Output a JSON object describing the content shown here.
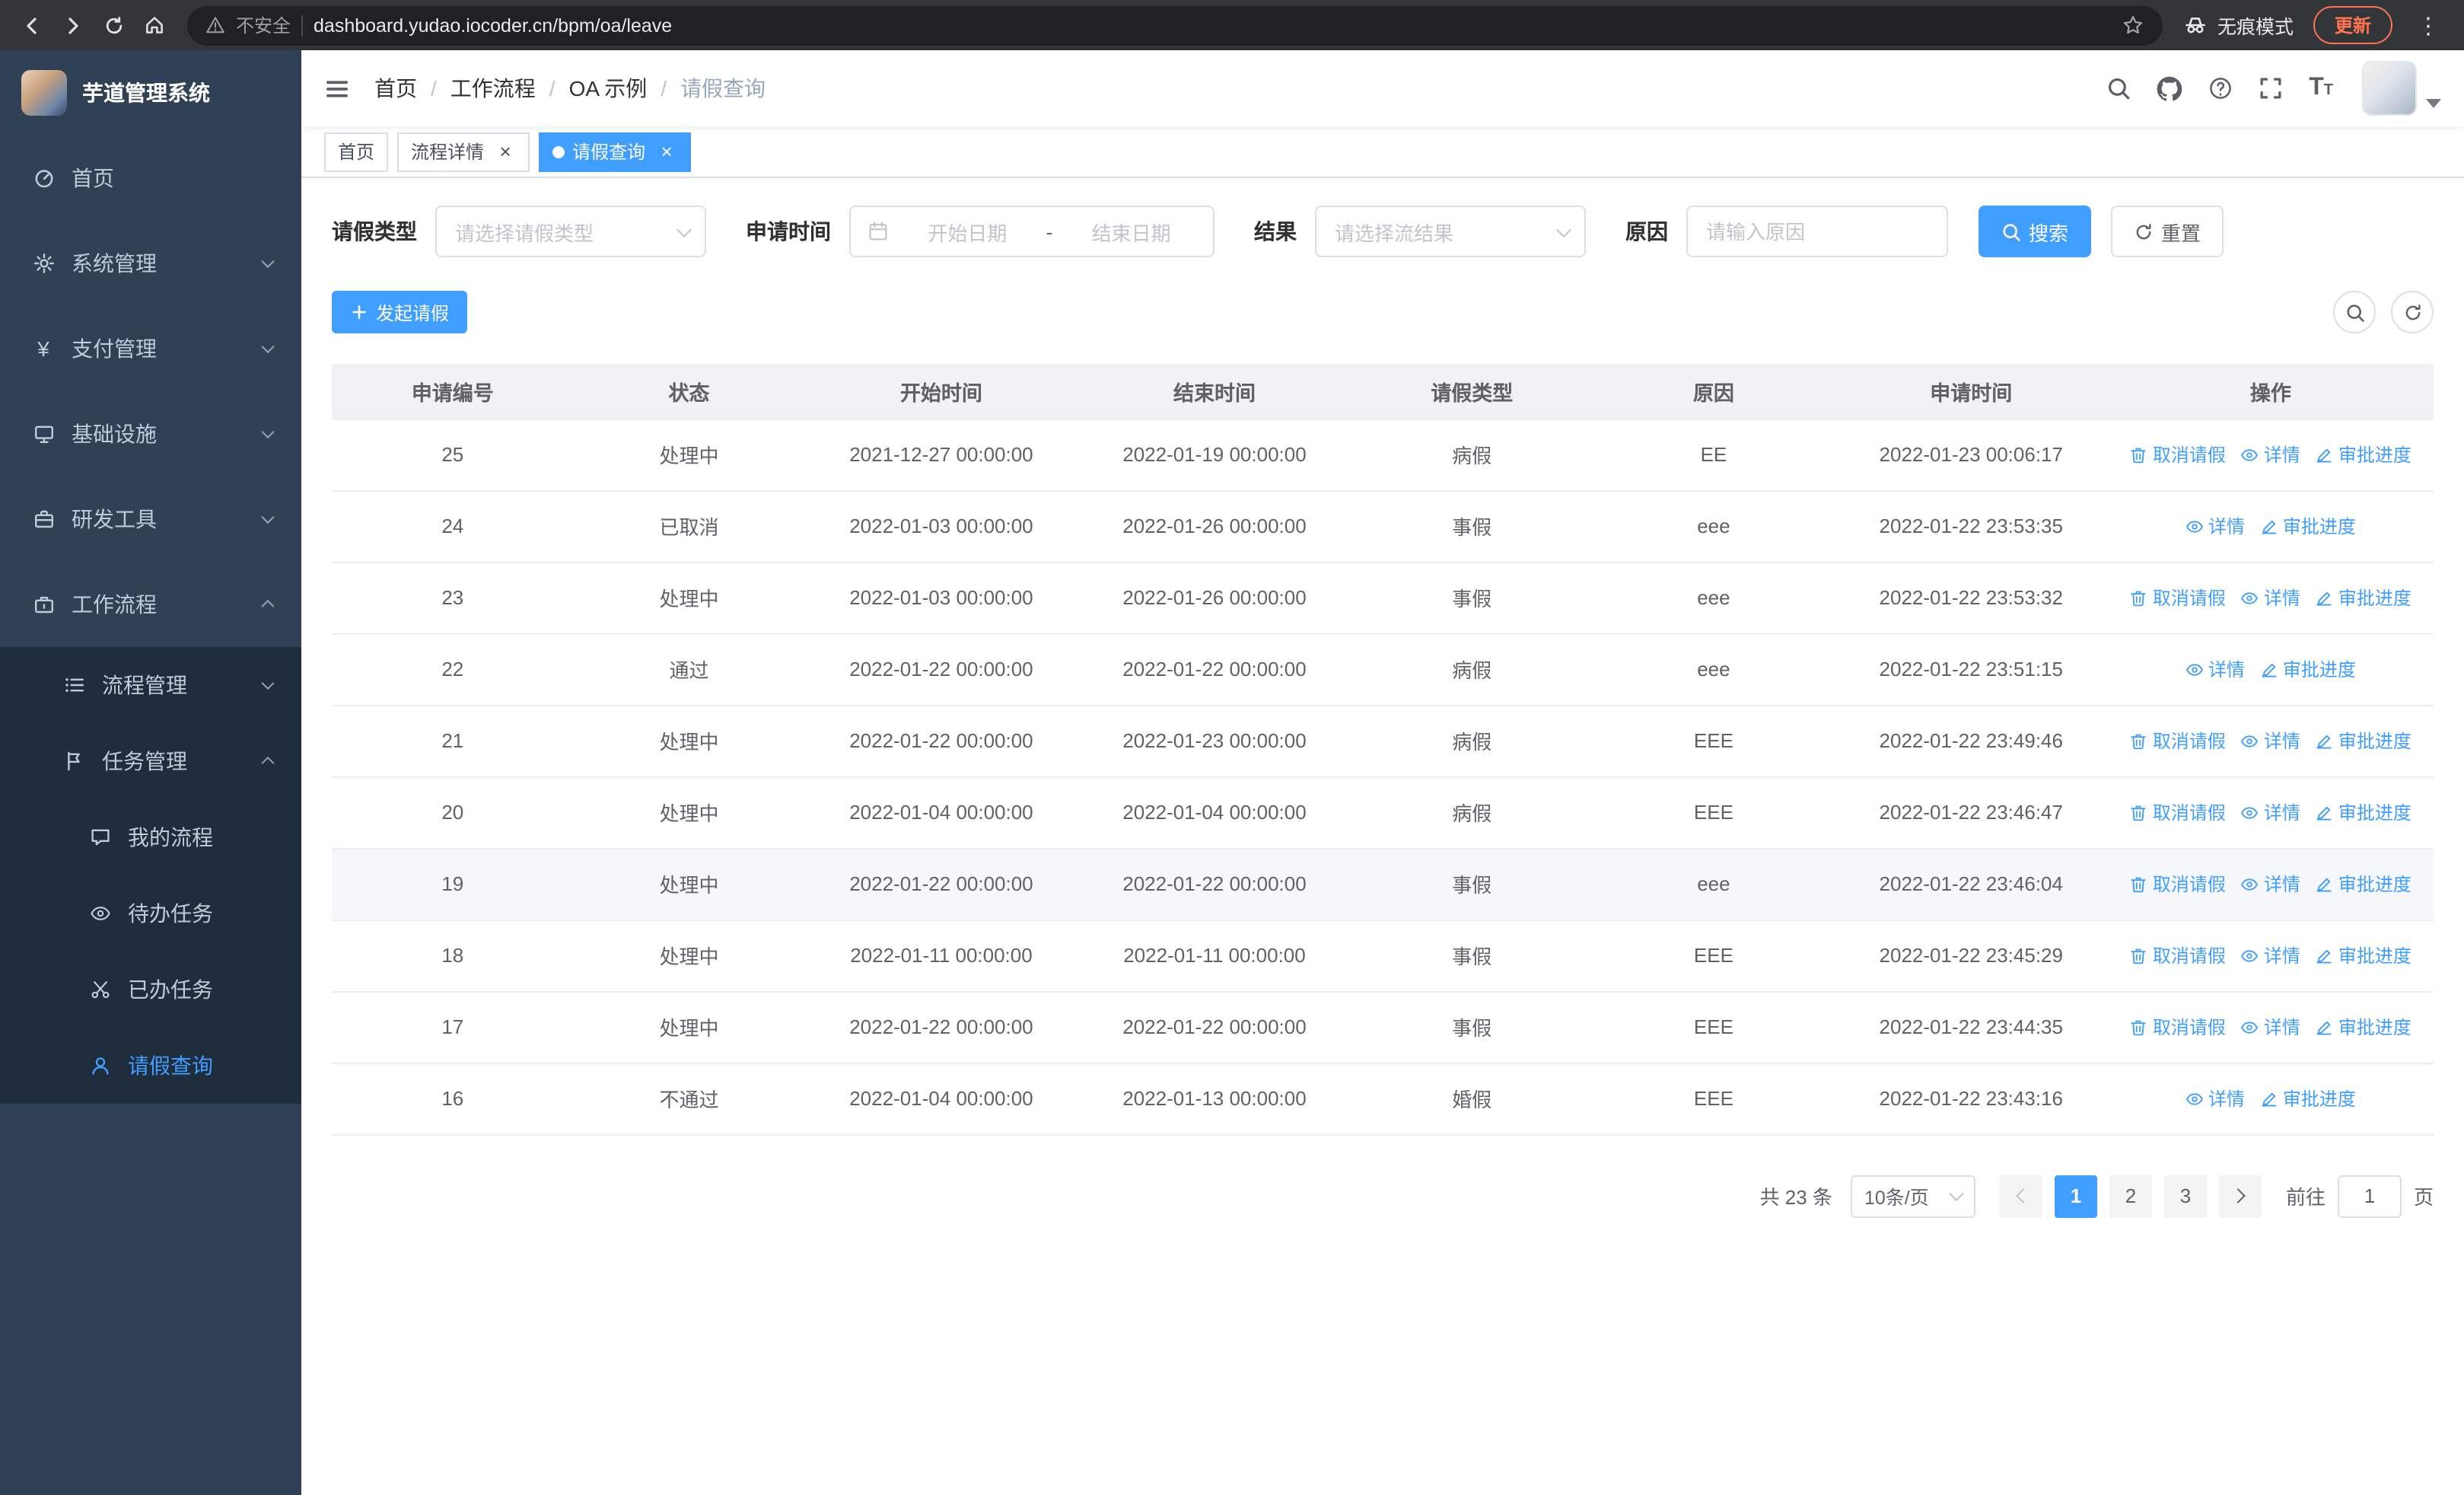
{
  "browser": {
    "security_label": "不安全",
    "url": "dashboard.yudao.iocoder.cn/bpm/oa/leave",
    "incognito_label": "无痕模式",
    "update_label": "更新"
  },
  "sidebar": {
    "title": "芋道管理系统",
    "items": [
      {
        "key": "home",
        "label": "首页",
        "icon": "dashboard",
        "level": 1
      },
      {
        "key": "system-management",
        "label": "系统管理",
        "icon": "gear",
        "level": 1,
        "arrow": "down"
      },
      {
        "key": "payment-management",
        "label": "支付管理",
        "icon": "yen",
        "level": 1,
        "arrow": "down"
      },
      {
        "key": "infrastructure",
        "label": "基础设施",
        "icon": "monitor",
        "level": 1,
        "arrow": "down"
      },
      {
        "key": "dev-tools",
        "label": "研发工具",
        "icon": "tools",
        "level": 1,
        "arrow": "down"
      },
      {
        "key": "workflow",
        "label": "工作流程",
        "icon": "workflow",
        "level": 1,
        "arrow": "up"
      },
      {
        "key": "process-management",
        "label": "流程管理",
        "icon": "list",
        "level": 2,
        "arrow": "down",
        "sub": true
      },
      {
        "key": "task-management",
        "label": "任务管理",
        "icon": "flag",
        "level": 2,
        "arrow": "up",
        "sub": true
      },
      {
        "key": "my-process",
        "label": "我的流程",
        "icon": "chat",
        "level": 3,
        "sub": true
      },
      {
        "key": "todo-tasks",
        "label": "待办任务",
        "icon": "eye",
        "level": 3,
        "sub": true
      },
      {
        "key": "done-tasks",
        "label": "已办任务",
        "icon": "scissors",
        "level": 3,
        "sub": true
      },
      {
        "key": "leave-query",
        "label": "请假查询",
        "icon": "user",
        "level": 3,
        "sub": true,
        "active": true
      }
    ]
  },
  "header": {
    "breadcrumb": [
      "首页",
      "工作流程",
      "OA 示例",
      "请假查询"
    ]
  },
  "tabs": [
    {
      "label": "首页",
      "closable": false,
      "active": false
    },
    {
      "label": "流程详情",
      "closable": true,
      "active": false
    },
    {
      "label": "请假查询",
      "closable": true,
      "active": true
    }
  ],
  "filters": {
    "leave_type": {
      "label": "请假类型",
      "placeholder": "请选择请假类型"
    },
    "apply_time": {
      "label": "申请时间",
      "start_placeholder": "开始日期",
      "separator": "-",
      "end_placeholder": "结束日期"
    },
    "result": {
      "label": "结果",
      "placeholder": "请选择流结果"
    },
    "reason": {
      "label": "原因",
      "placeholder": "请输入原因"
    },
    "search_label": "搜索",
    "reset_label": "重置"
  },
  "toolbar": {
    "create_label": "发起请假"
  },
  "table": {
    "columns": [
      "申请编号",
      "状态",
      "开始时间",
      "结束时间",
      "请假类型",
      "原因",
      "申请时间",
      "操作"
    ],
    "action_labels": {
      "cancel": "取消请假",
      "detail": "详情",
      "progress": "审批进度"
    },
    "rows": [
      {
        "id": "25",
        "status": "处理中",
        "start": "2021-12-27 00:00:00",
        "end": "2022-01-19 00:00:00",
        "type": "病假",
        "reason": "EE",
        "applied": "2022-01-23 00:06:17",
        "cancellable": true,
        "highlighted": false
      },
      {
        "id": "24",
        "status": "已取消",
        "start": "2022-01-03 00:00:00",
        "end": "2022-01-26 00:00:00",
        "type": "事假",
        "reason": "eee",
        "applied": "2022-01-22 23:53:35",
        "cancellable": false,
        "highlighted": false
      },
      {
        "id": "23",
        "status": "处理中",
        "start": "2022-01-03 00:00:00",
        "end": "2022-01-26 00:00:00",
        "type": "事假",
        "reason": "eee",
        "applied": "2022-01-22 23:53:32",
        "cancellable": true,
        "highlighted": false
      },
      {
        "id": "22",
        "status": "通过",
        "start": "2022-01-22 00:00:00",
        "end": "2022-01-22 00:00:00",
        "type": "病假",
        "reason": "eee",
        "applied": "2022-01-22 23:51:15",
        "cancellable": false,
        "highlighted": false
      },
      {
        "id": "21",
        "status": "处理中",
        "start": "2022-01-22 00:00:00",
        "end": "2022-01-23 00:00:00",
        "type": "病假",
        "reason": "EEE",
        "applied": "2022-01-22 23:49:46",
        "cancellable": true,
        "highlighted": false
      },
      {
        "id": "20",
        "status": "处理中",
        "start": "2022-01-04 00:00:00",
        "end": "2022-01-04 00:00:00",
        "type": "病假",
        "reason": "EEE",
        "applied": "2022-01-22 23:46:47",
        "cancellable": true,
        "highlighted": false
      },
      {
        "id": "19",
        "status": "处理中",
        "start": "2022-01-22 00:00:00",
        "end": "2022-01-22 00:00:00",
        "type": "事假",
        "reason": "eee",
        "applied": "2022-01-22 23:46:04",
        "cancellable": true,
        "highlighted": true
      },
      {
        "id": "18",
        "status": "处理中",
        "start": "2022-01-11 00:00:00",
        "end": "2022-01-11 00:00:00",
        "type": "事假",
        "reason": "EEE",
        "applied": "2022-01-22 23:45:29",
        "cancellable": true,
        "highlighted": false
      },
      {
        "id": "17",
        "status": "处理中",
        "start": "2022-01-22 00:00:00",
        "end": "2022-01-22 00:00:00",
        "type": "事假",
        "reason": "EEE",
        "applied": "2022-01-22 23:44:35",
        "cancellable": true,
        "highlighted": false
      },
      {
        "id": "16",
        "status": "不通过",
        "start": "2022-01-04 00:00:00",
        "end": "2022-01-13 00:00:00",
        "type": "婚假",
        "reason": "EEE",
        "applied": "2022-01-22 23:43:16",
        "cancellable": false,
        "highlighted": false
      }
    ]
  },
  "pagination": {
    "total_label": "共 23 条",
    "page_size_label": "10条/页",
    "pages": [
      "1",
      "2",
      "3"
    ],
    "active_page": "1",
    "goto_label": "前往",
    "goto_value": "1",
    "goto_suffix": "页"
  },
  "colors": {
    "accent": "#409eff",
    "sidebar_bg": "#304156",
    "submenu_bg": "#1f2d3d",
    "sidebar_text": "#bfcbd9",
    "active_tab_bg": "#409eff",
    "update_badge": "#ff7151",
    "table_header_bg": "#f0f2f5",
    "row_highlight": "#f5f7fa"
  }
}
